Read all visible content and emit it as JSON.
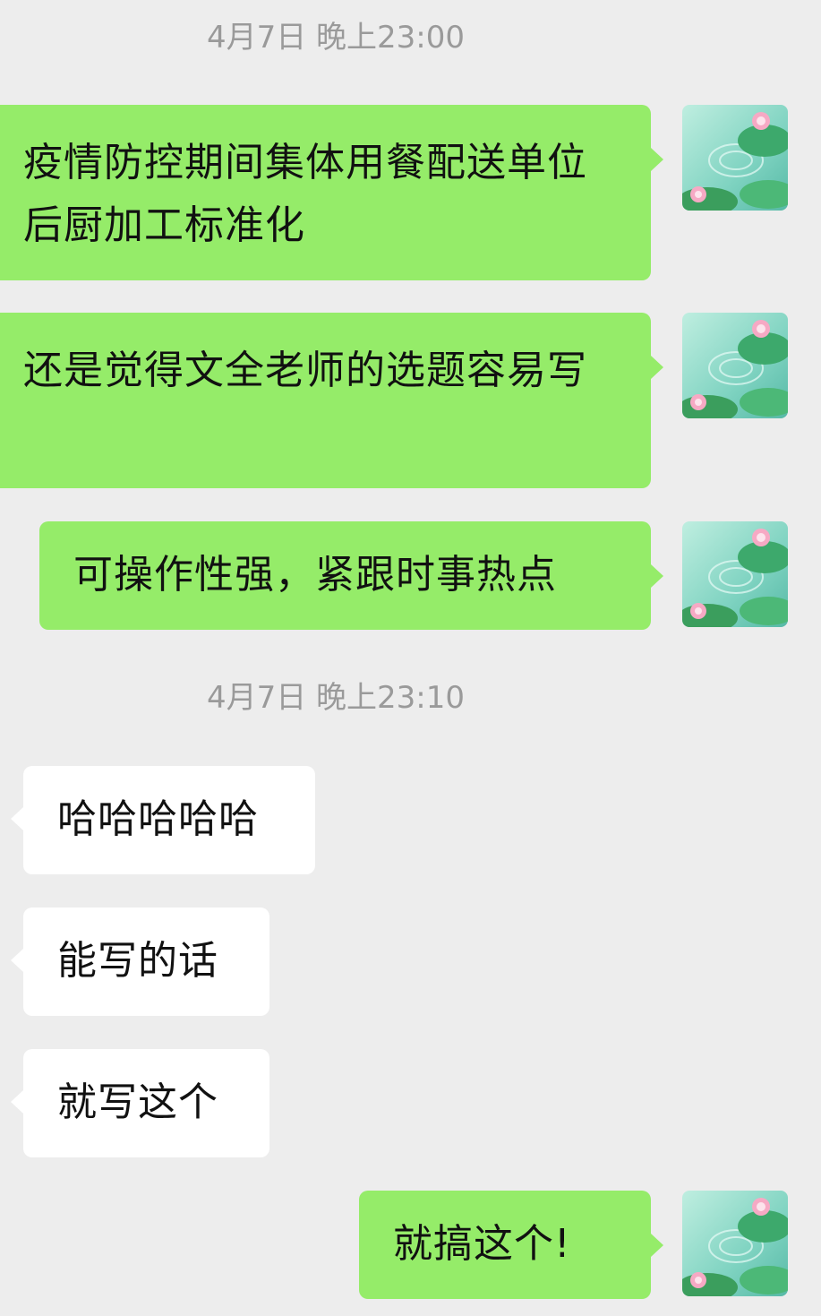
{
  "timestamps": [
    "4月7日 晚上23:00",
    "4月7日 晚上23:10"
  ],
  "messages": [
    {
      "side": "sent",
      "text": "疫情防控期间集体用餐配送单位后厨加工标准化"
    },
    {
      "side": "sent",
      "text": "还是觉得文全老师的选题容易写"
    },
    {
      "side": "sent",
      "text": "可操作性强，紧跟时事热点"
    },
    {
      "side": "recv",
      "text": "哈哈哈哈哈"
    },
    {
      "side": "recv",
      "text": "能写的话"
    },
    {
      "side": "recv",
      "text": "就写这个"
    },
    {
      "side": "sent",
      "text": "就搞这个!"
    }
  ],
  "avatar_icon": "lotus-pond-avatar-icon",
  "colors": {
    "background": "#ededed",
    "sent_bubble": "#95ec69",
    "received_bubble": "#ffffff",
    "timestamp_text": "#9a9a9a"
  }
}
